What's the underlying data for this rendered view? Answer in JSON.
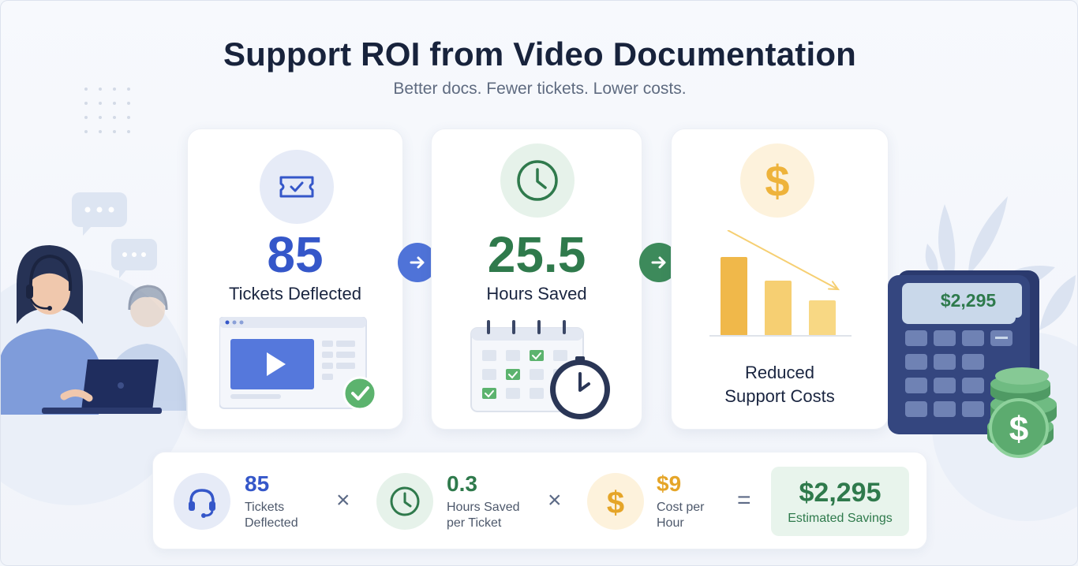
{
  "header": {
    "title": "Support ROI from Video Documentation",
    "subtitle": "Better docs. Fewer tickets. Lower costs."
  },
  "cards": [
    {
      "value": "85",
      "label": "Tickets Deflected",
      "icon": "ticket-icon",
      "color": "#3557c9"
    },
    {
      "value": "25.5",
      "label": "Hours Saved",
      "icon": "clock-icon",
      "color": "#2f7a4c"
    },
    {
      "label_line1": "Reduced",
      "label_line2": "Support Costs",
      "icon": "dollar-icon",
      "color": "#eeb33b"
    }
  ],
  "formula": {
    "item1": {
      "value": "85",
      "label_line1": "Tickets",
      "label_line2": "Deflected",
      "icon": "headset-icon",
      "color": "#3557c9"
    },
    "op1": "×",
    "item2": {
      "value": "0.3",
      "label_line1": "Hours Saved",
      "label_line2": "per Ticket",
      "icon": "clock-icon",
      "color": "#2f7a4c"
    },
    "op2": "×",
    "item3": {
      "value": "$9",
      "label_line1": "Cost per",
      "label_line2": "Hour",
      "icon": "dollar-icon",
      "color": "#e5a528"
    },
    "op3": "=",
    "result": {
      "value": "$2,295",
      "label": "Estimated Savings"
    }
  },
  "calculator": {
    "display": "$2,295"
  },
  "chart_data": {
    "type": "bar",
    "categories": [
      "",
      "",
      ""
    ],
    "values": [
      3,
      2.1,
      1.35
    ],
    "title": "",
    "xlabel": "",
    "ylabel": "",
    "trend": "decreasing"
  }
}
